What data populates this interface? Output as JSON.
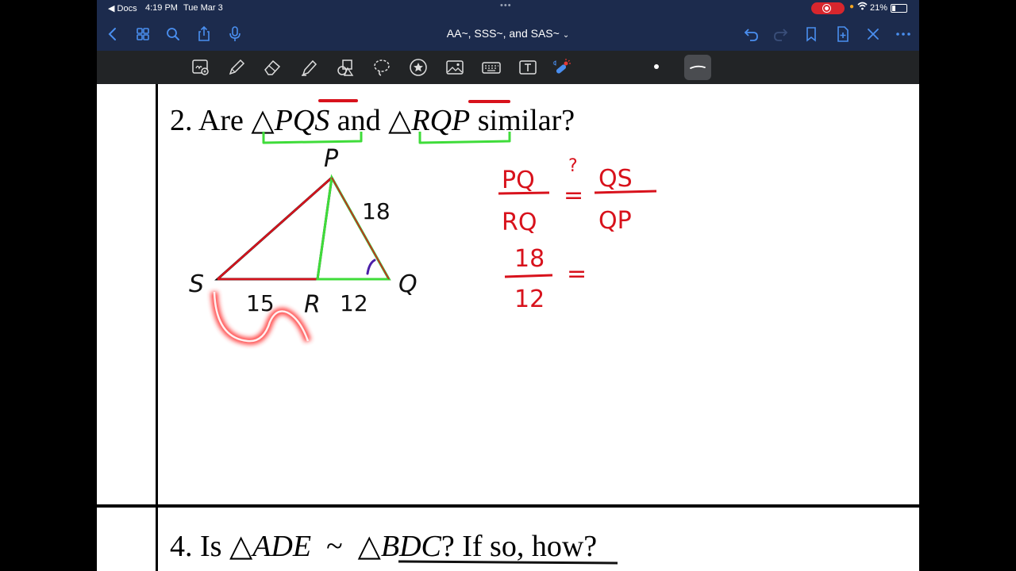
{
  "status_bar": {
    "back_app": "◀ Docs",
    "time": "4:19 PM",
    "date": "Tue Mar 3",
    "battery": "21%"
  },
  "nav": {
    "title": "AA~, SSS~, and SAS~",
    "icons": [
      "back-chevron",
      "grid",
      "search",
      "share",
      "microphone",
      "undo",
      "redo",
      "bookmark",
      "add-page",
      "close",
      "more"
    ]
  },
  "toolbar": {
    "tools": [
      "zoom-box",
      "pen",
      "eraser",
      "highlighter",
      "shapes",
      "lasso",
      "elements",
      "image",
      "keyboard",
      "text",
      "laser"
    ]
  },
  "question2": {
    "number": "2.",
    "prefix": "Are",
    "tri1": "PQS",
    "conj": "and",
    "tri2": "RQP",
    "suffix": "similar?"
  },
  "figure": {
    "label_p": "P",
    "label_s": "S",
    "label_q": "Q",
    "label_r": "R",
    "side_pq": "18",
    "side_sr": "15",
    "side_rq": "12"
  },
  "handwriting": {
    "ratio1_num": "PQ",
    "ratio1_den": "RQ",
    "question_mark": "?",
    "ratio2_num": "QS",
    "ratio2_den": "QP",
    "value_num": "18",
    "value_den": "12",
    "equals": "="
  },
  "question4": {
    "number": "4.",
    "prefix": "Is",
    "tri1": "ADE",
    "tilde": "~",
    "tri2": "BDC",
    "suffix": "? If so, how?"
  },
  "colors": {
    "ios_blue": "#4a8ff0",
    "nav_bg": "#1c2b4d",
    "toolbar_bg": "#222426",
    "ink_red": "#d8121c",
    "ink_green": "#3fdc3a",
    "ink_purple": "#4b1fa8"
  }
}
